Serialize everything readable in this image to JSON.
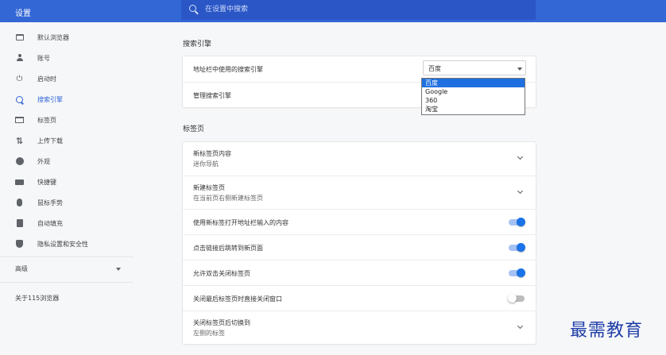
{
  "header": {
    "title": "设置",
    "search_placeholder": "在设置中搜索"
  },
  "sidebar": {
    "items": [
      {
        "label": "默认浏览器",
        "icon": "browser-icon",
        "active": false
      },
      {
        "label": "账号",
        "icon": "person-icon",
        "active": false
      },
      {
        "label": "启动时",
        "icon": "power-icon",
        "active": false
      },
      {
        "label": "搜索引擎",
        "icon": "search-icon",
        "active": true
      },
      {
        "label": "标签页",
        "icon": "tab-icon",
        "active": false
      },
      {
        "label": "上传下载",
        "icon": "transfer-icon",
        "active": false
      },
      {
        "label": "外观",
        "icon": "palette-icon",
        "active": false
      },
      {
        "label": "快捷键",
        "icon": "keyboard-icon",
        "active": false
      },
      {
        "label": "鼠标手势",
        "icon": "mouse-icon",
        "active": false
      },
      {
        "label": "自动填充",
        "icon": "clipboard-icon",
        "active": false
      },
      {
        "label": "隐私设置和安全性",
        "icon": "shield-icon",
        "active": false
      }
    ],
    "advanced_label": "高级",
    "about_label": "关于115浏览器"
  },
  "search_engine": {
    "section_title": "搜索引擎",
    "address_bar_label": "地址栏中使用的搜索引擎",
    "selected": "百度",
    "options": [
      "百度",
      "Google",
      "360",
      "淘宝"
    ],
    "manage_label": "管理搜索引擎"
  },
  "tabs": {
    "section_title": "标签页",
    "rows": [
      {
        "title": "新标签页内容",
        "subtitle": "迷你导航",
        "control": "chevron"
      },
      {
        "title": "新建标签页",
        "subtitle": "在当前页右侧新建标签页",
        "control": "chevron"
      },
      {
        "title": "使用新标签打开地址栏输入的内容",
        "control": "toggle",
        "on": true
      },
      {
        "title": "点击链接后跳转到新页面",
        "control": "toggle",
        "on": true
      },
      {
        "title": "允许双击关闭标签页",
        "control": "toggle",
        "on": true
      },
      {
        "title": "关闭最后标签页时直接关闭窗口",
        "control": "toggle",
        "on": false
      },
      {
        "title": "关闭标签页后切换到",
        "subtitle": "左侧的标签",
        "control": "chevron"
      }
    ]
  },
  "watermark": "最需教育",
  "colors": {
    "header": "#3367d6",
    "accent": "#1a73e8",
    "toggle_track_on": "#a6c1f3"
  }
}
